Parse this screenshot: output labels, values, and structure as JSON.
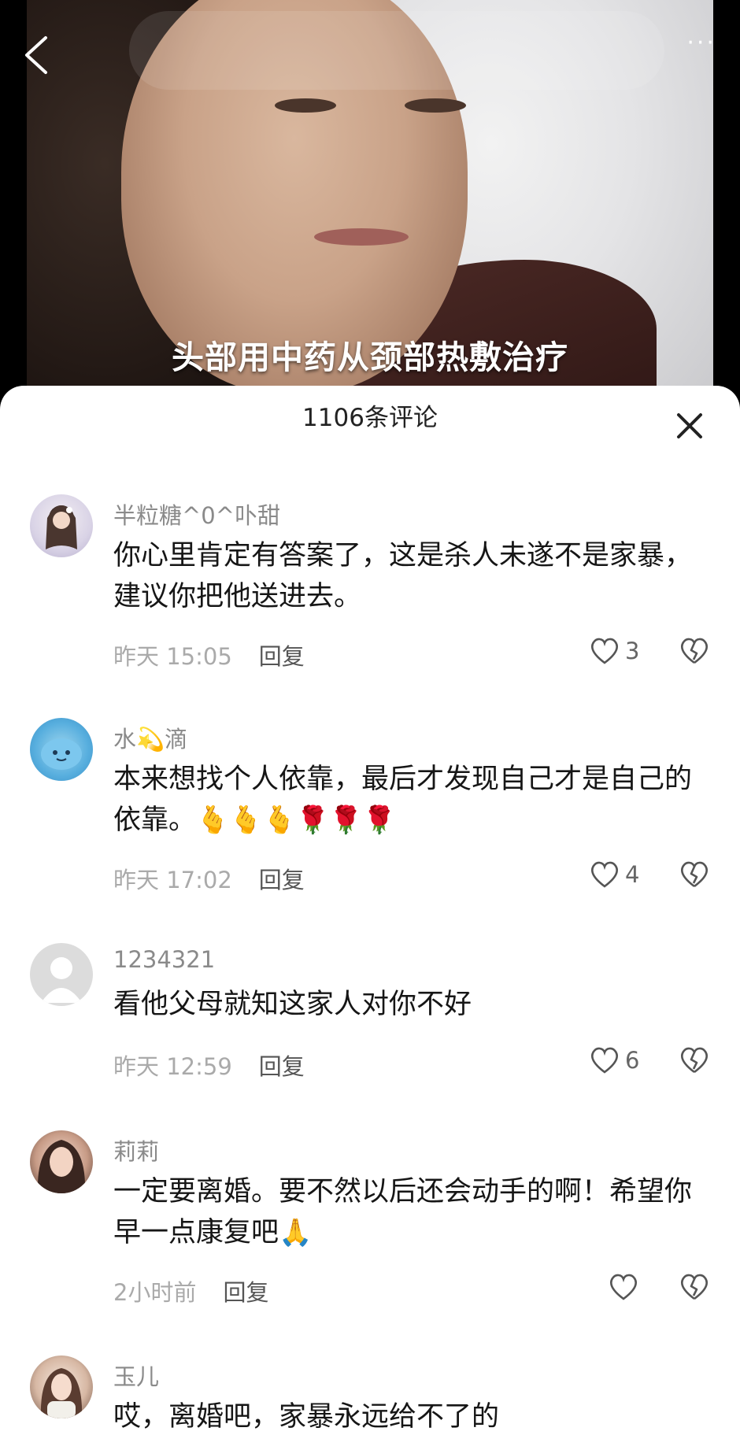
{
  "video": {
    "subtitle": "头部用中药从颈部热敷治疗"
  },
  "top_bar": {
    "back_icon": "chevron-left-icon",
    "more_label": "···"
  },
  "sheet": {
    "title": "1106条评论",
    "close_icon": "close-icon"
  },
  "comments": [
    {
      "name": "半粒糖^0^卟甜",
      "text": "你心里肯定有答案了，这是杀人未遂不是家暴，建议你把他送进去。",
      "time": "昨天 15:05",
      "reply": "回复",
      "likes": "3"
    },
    {
      "name_pre": "水",
      "name_emoji": "💫",
      "name_post": "滴",
      "text": "本来想找个人依靠，最后才发现自己才是自己的依靠。",
      "emoji_tail": "🫰🫰🫰🌹🌹🌹",
      "time": "昨天 17:02",
      "reply": "回复",
      "likes": "4"
    },
    {
      "name": "1234321",
      "text": "看他父母就知这家人对你不好",
      "time": "昨天 12:59",
      "reply": "回复",
      "likes": "6"
    },
    {
      "name": "莉莉",
      "text": "一定要离婚。要不然以后还会动手的啊！希望你早一点康复吧",
      "emoji_tail": "🙏",
      "time": "2小时前",
      "reply": "回复",
      "likes": ""
    },
    {
      "name": "玉儿",
      "text": "哎，离婚吧，家暴永远给不了的"
    }
  ],
  "colors": {
    "sheet_bg": "#ffffff",
    "meta_text": "#aaaaaa",
    "name_text": "#8a8a8a",
    "body_text": "#161616"
  }
}
